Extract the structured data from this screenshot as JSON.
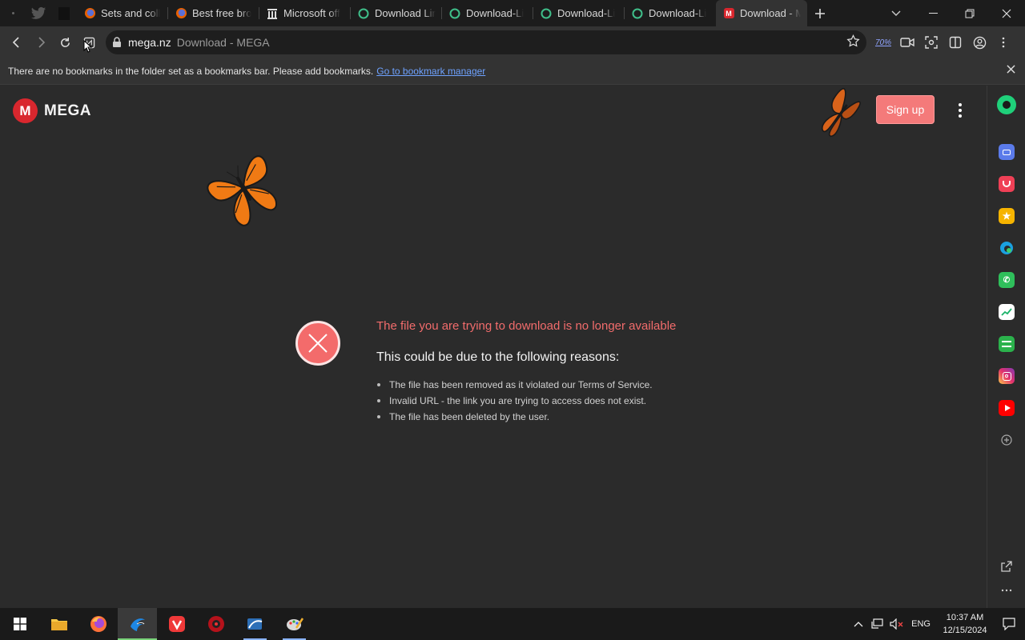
{
  "browser": {
    "tabs": [
      {
        "title": "Sets and coll",
        "favicon": "firefox-icon",
        "active": false
      },
      {
        "title": "Best free bro",
        "favicon": "firefox-icon",
        "active": false
      },
      {
        "title": "Microsoft off",
        "favicon": "building-icon",
        "active": false
      },
      {
        "title": "Download Lin",
        "favicon": "ring-icon",
        "active": false
      },
      {
        "title": "Download-Li",
        "favicon": "ring-icon",
        "active": false
      },
      {
        "title": "Download-Li",
        "favicon": "ring-icon",
        "active": false
      },
      {
        "title": "Download-Li",
        "favicon": "ring-icon",
        "active": false
      },
      {
        "title": "Download - M",
        "favicon": "mega-icon",
        "active": true
      }
    ],
    "address": {
      "host": "mega.nz",
      "page_title": "Download - MEGA"
    },
    "zoom": "70%",
    "bookmarks_bar": {
      "message": "There are no bookmarks in the folder set as a bookmarks bar. Please add bookmarks.",
      "link": "Go to bookmark manager"
    }
  },
  "page": {
    "logo_letter": "M",
    "logo_text": "MEGA",
    "signup_label": "Sign up",
    "error_title": "The file you are trying to download is no longer available",
    "error_subtitle": "This could be due to the following reasons:",
    "reasons": [
      "The file has been removed as it violated our Terms of Service.",
      "Invalid URL - the link you are trying to access does not exist.",
      "The file has been deleted by the user."
    ]
  },
  "colors": {
    "accent": "#d9272e",
    "error_text": "#f26c6c",
    "signup_bg": "#f47a7a",
    "page_bg": "#2b2b2b"
  },
  "taskbar": {
    "language": "ENG",
    "time": "10:37 AM",
    "date": "12/15/2024"
  }
}
